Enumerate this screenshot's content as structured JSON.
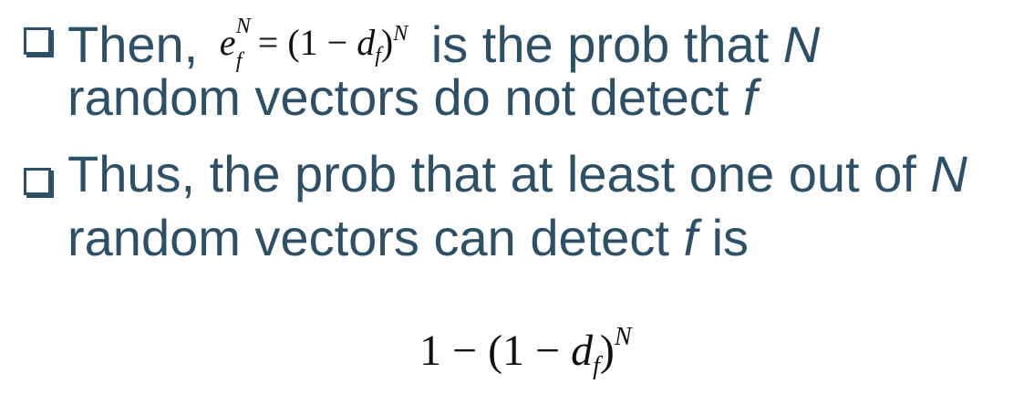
{
  "bullet1": {
    "prefix": "Then,",
    "math": {
      "e": "e",
      "e_sup": "N",
      "e_sub": "f",
      "eq_left": "= (1 − ",
      "d": "d",
      "d_sub": "f",
      "close": ")",
      "exp": "N"
    },
    "suffix_pre": "is the prob that",
    "suffix_var": "N",
    "line2_pre": "random vectors do not detect",
    "line2_var": "f"
  },
  "bullet2": {
    "line1_pre": "Thus, the prob that at least one out of",
    "line1_var": "N",
    "line2_pre": "random vectors can detect",
    "line2_var": "f",
    "line2_post": "is"
  },
  "formula": {
    "lead": "1 − (1 − ",
    "d": "d",
    "d_sub": "f",
    "close": ")",
    "exp": "N"
  }
}
